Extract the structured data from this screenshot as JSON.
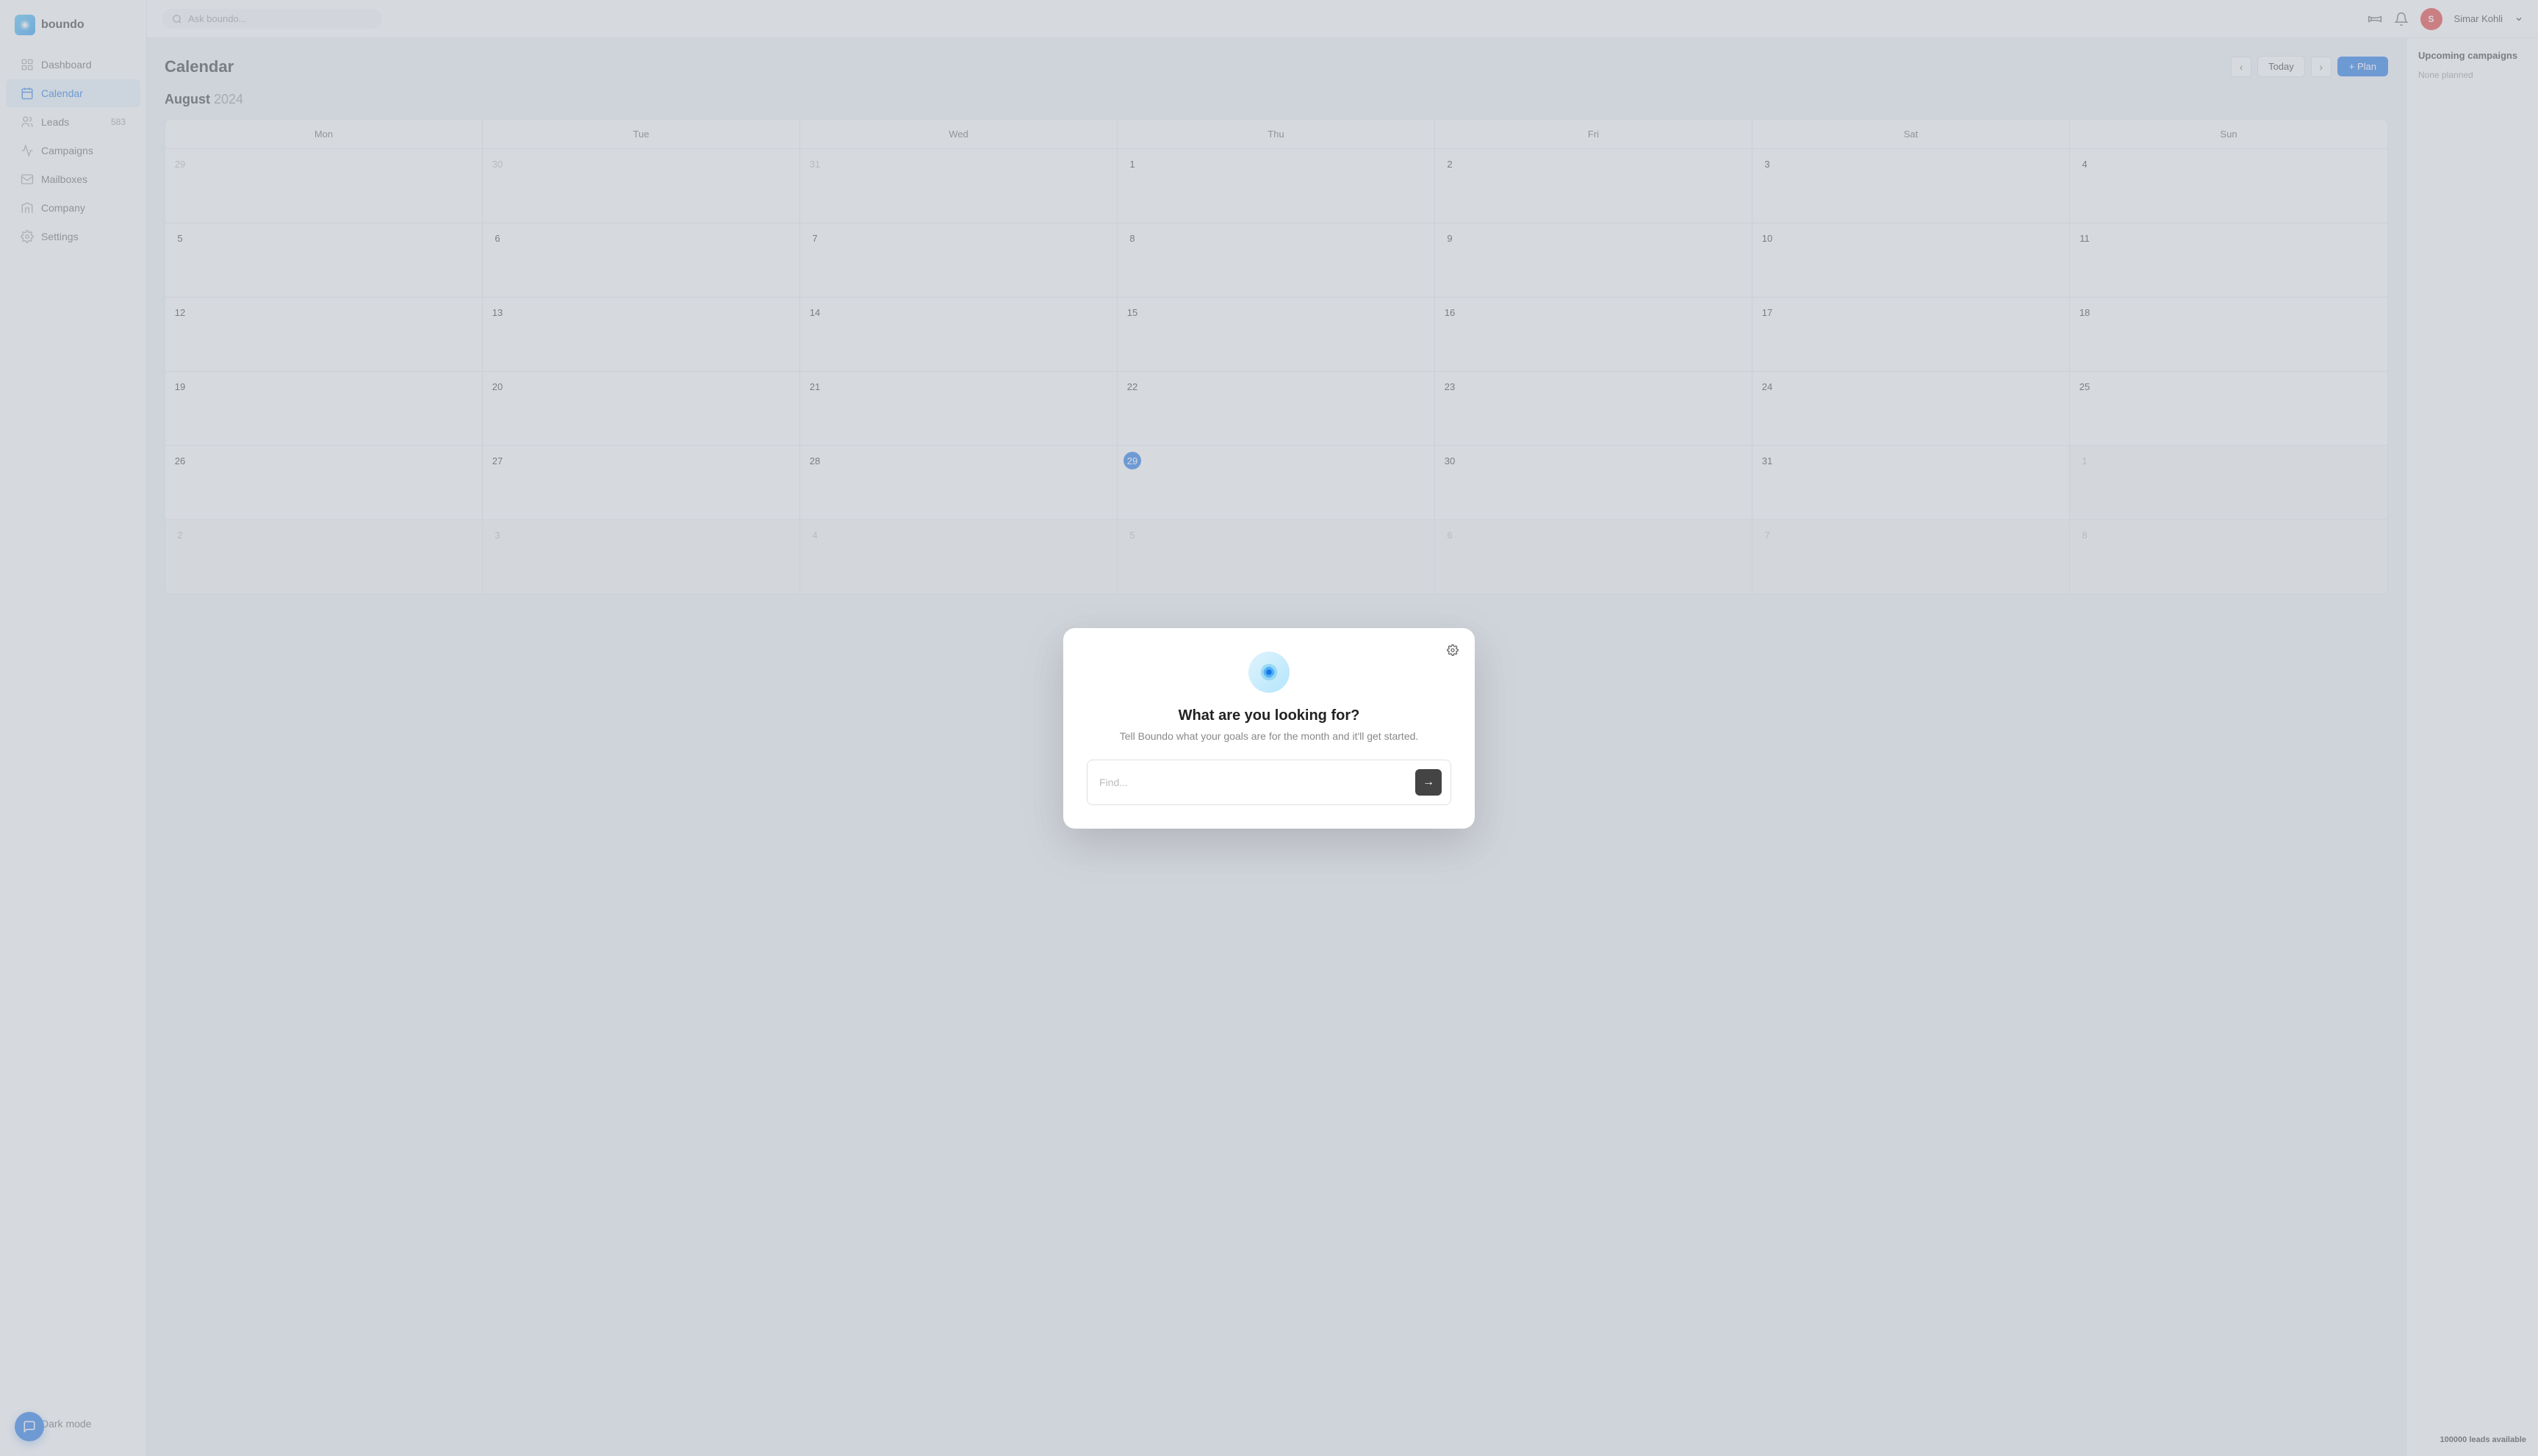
{
  "app": {
    "name": "boundo"
  },
  "topbar": {
    "search_placeholder": "Ask boundo...",
    "user_name": "Simar Kohli",
    "user_initials": "S"
  },
  "sidebar": {
    "items": [
      {
        "id": "dashboard",
        "label": "Dashboard",
        "badge": "",
        "active": false
      },
      {
        "id": "calendar",
        "label": "Calendar",
        "badge": "",
        "active": true
      },
      {
        "id": "leads",
        "label": "Leads",
        "badge": "583",
        "active": false
      },
      {
        "id": "campaigns",
        "label": "Campaigns",
        "badge": "",
        "active": false
      },
      {
        "id": "mailboxes",
        "label": "Mailboxes",
        "badge": "",
        "active": false
      },
      {
        "id": "company",
        "label": "Company",
        "badge": "",
        "active": false
      },
      {
        "id": "settings",
        "label": "Settings",
        "badge": "",
        "active": false
      },
      {
        "id": "darkmode",
        "label": "Dark mode",
        "badge": "",
        "active": false
      }
    ]
  },
  "calendar": {
    "title": "Calendar",
    "month": "August",
    "year": "2024",
    "today_label": "Today",
    "plan_label": "+ Plan",
    "days_header": [
      "Mon",
      "Tue",
      "Wed",
      "Thu",
      "Fri",
      "Sat",
      "Sun"
    ],
    "weeks": [
      [
        {
          "num": "29",
          "other": true
        },
        {
          "num": "30",
          "other": true
        },
        {
          "num": "31",
          "other": true
        },
        {
          "num": "1",
          "other": false
        },
        {
          "num": "2",
          "other": false
        },
        {
          "num": "3",
          "other": false
        },
        {
          "num": "4",
          "other": false
        }
      ],
      [
        {
          "num": "5",
          "other": false
        },
        {
          "num": "6",
          "other": false
        },
        {
          "num": "7",
          "other": false
        },
        {
          "num": "8",
          "other": false
        },
        {
          "num": "9",
          "other": false
        },
        {
          "num": "10",
          "other": false
        },
        {
          "num": "11",
          "other": false
        }
      ],
      [
        {
          "num": "12",
          "other": false
        },
        {
          "num": "13",
          "other": false
        },
        {
          "num": "14",
          "other": false
        },
        {
          "num": "15",
          "other": false
        },
        {
          "num": "16",
          "other": false
        },
        {
          "num": "17",
          "other": false
        },
        {
          "num": "18",
          "other": false
        }
      ],
      [
        {
          "num": "19",
          "other": false
        },
        {
          "num": "20",
          "other": false
        },
        {
          "num": "21",
          "other": false
        },
        {
          "num": "22",
          "other": false
        },
        {
          "num": "23",
          "other": false
        },
        {
          "num": "24",
          "other": false
        },
        {
          "num": "25",
          "other": false
        }
      ],
      [
        {
          "num": "26",
          "other": false
        },
        {
          "num": "27",
          "other": false
        },
        {
          "num": "28",
          "other": false
        },
        {
          "num": "29",
          "other": false,
          "today": true
        },
        {
          "num": "30",
          "other": false
        },
        {
          "num": "31",
          "other": false
        },
        {
          "num": "1",
          "other": true,
          "faded": true
        }
      ],
      [
        {
          "num": "2",
          "other": true,
          "faded": true
        },
        {
          "num": "3",
          "other": true,
          "faded": true
        },
        {
          "num": "4",
          "other": true,
          "faded": true
        },
        {
          "num": "5",
          "other": true,
          "faded": true
        },
        {
          "num": "6",
          "other": true,
          "faded": true
        },
        {
          "num": "7",
          "other": true,
          "faded": true
        },
        {
          "num": "8",
          "other": true,
          "faded": true
        }
      ]
    ]
  },
  "right_panel": {
    "upcoming_campaigns_title": "Upcoming campaigns",
    "none_planned_text": "None planned",
    "leads_available_count": "100000",
    "leads_available_label": "leads available"
  },
  "modal": {
    "title": "What are you looking for?",
    "subtitle": "Tell Boundo what your goals are for the month and it'll get started.",
    "input_placeholder": "Find...",
    "submit_arrow": "→"
  }
}
